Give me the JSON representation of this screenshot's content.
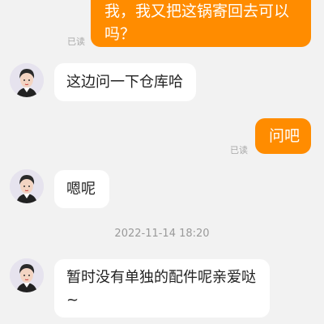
{
  "messages": [
    {
      "from": "me",
      "text_line1": "我，我又把这锅寄回去可以",
      "text_line2": "吗？",
      "status": "已读"
    },
    {
      "from": "agent",
      "text": "这边问一下仓库哈"
    },
    {
      "from": "me",
      "text": "问吧",
      "status": "已读"
    },
    {
      "from": "agent",
      "text": "嗯呢"
    },
    {
      "from": "agent",
      "text_line1": "暂时没有单独的配件呢亲爱哒",
      "text_line2": "~"
    }
  ],
  "timestamp": "2022-11-14 18:20",
  "colors": {
    "outgoing_bubble": "#ff8c00",
    "incoming_bubble": "#ffffff",
    "background": "#f2f2f2"
  },
  "icons": {
    "agent_avatar": "customer-service-agent-avatar"
  }
}
